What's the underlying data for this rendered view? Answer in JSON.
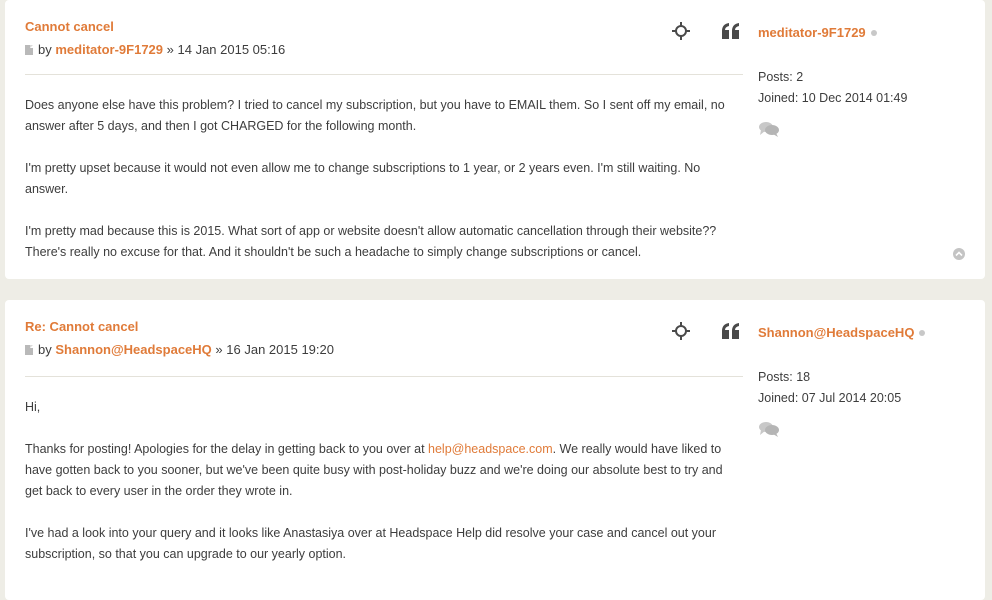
{
  "posts": [
    {
      "title": "Cannot cancel",
      "by_label": "by",
      "author": "meditator-9F1729",
      "date_sep": "»",
      "date": "14 Jan 2015 05:16",
      "paragraphs": [
        "Does anyone else have this problem? I tried to cancel my subscription, but you have to EMAIL them. So I sent off my email, no answer after 5 days, and then I got CHARGED for the following month.",
        "I'm pretty upset because it would not even allow me to change subscriptions to 1 year, or 2 years even. I'm still waiting. No answer.",
        "I'm pretty mad because this is 2015. What sort of app or website doesn't allow automatic cancellation through their website?? There's really no excuse for that. And it shouldn't be such a headache to simply change subscriptions or cancel."
      ],
      "profile": {
        "username": "meditator-9F1729",
        "posts_label": "Posts:",
        "posts_value": "2",
        "joined_label": "Joined:",
        "joined_value": "10 Dec 2014 01:49"
      }
    },
    {
      "title": "Re: Cannot cancel",
      "by_label": "by",
      "author": "Shannon@HeadspaceHQ",
      "date_sep": "»",
      "date": "16 Jan 2015 19:20",
      "paragraph_1": "Hi,",
      "paragraph_2_before": "Thanks for posting! Apologies for the delay in getting back to you over at ",
      "paragraph_2_link": "help@headspace.com",
      "paragraph_2_after": ". We really would have liked to have gotten back to you sooner, but we've been quite busy with post-holiday buzz and we're doing our absolute best to try and get back to every user in the order they wrote in.",
      "paragraph_3": "I've had a look into your query and it looks like Anastasiya over at Headspace Help did resolve your case and cancel out your subscription, so that you can upgrade to our yearly option.",
      "profile": {
        "username": "Shannon@HeadspaceHQ",
        "posts_label": "Posts:",
        "posts_value": "18",
        "joined_label": "Joined:",
        "joined_value": "07 Jul 2014 20:05"
      }
    }
  ],
  "icons": {
    "post_link": "crosshair-icon",
    "quote": "quote-icon",
    "post_type": "document-icon",
    "online_status": "offline-dot",
    "private_message": "speech-bubbles-icon",
    "back_to_top": "arrow-up-circle-icon"
  },
  "colors": {
    "accent": "#e07b39",
    "page_bg": "#eeede6",
    "card_bg": "#ffffff",
    "text": "#3d3d3d",
    "icon": "#4a4a4a"
  }
}
